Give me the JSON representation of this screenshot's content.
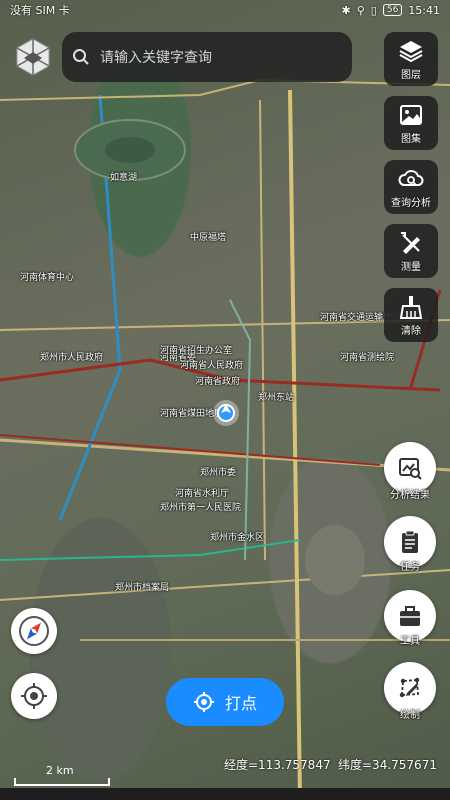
{
  "status_bar": {
    "carrier": "没有 SIM 卡",
    "battery": "56",
    "time": "15:41"
  },
  "search": {
    "placeholder": "请输入关键字查询"
  },
  "toolbar": [
    {
      "id": "layers",
      "label": "图层",
      "icon": "layers-icon"
    },
    {
      "id": "gallery",
      "label": "图集",
      "icon": "image-icon"
    },
    {
      "id": "query",
      "label": "查询分析",
      "icon": "cloud-search-icon"
    },
    {
      "id": "measure",
      "label": "测量",
      "icon": "ruler-pencil-icon"
    },
    {
      "id": "clear",
      "label": "清除",
      "icon": "broom-icon"
    }
  ],
  "actions": [
    {
      "id": "analysis-result",
      "label": "分析结果",
      "icon": "chart-search-icon"
    },
    {
      "id": "task",
      "label": "任务",
      "icon": "clipboard-icon"
    },
    {
      "id": "tools",
      "label": "工具",
      "icon": "toolbox-icon"
    },
    {
      "id": "draw",
      "label": "绘制",
      "icon": "draw-polygon-icon"
    }
  ],
  "point_button": "打点",
  "scale_label": "2 km",
  "coordinates": {
    "longitude": "经度=113.757847",
    "latitude": "纬度=34.757671"
  },
  "map_labels": [
    "河南省委",
    "河南省人民政府",
    "河南省政府",
    "河南省煤田地质局",
    "郑州东站",
    "郑州市人民政府",
    "河南省测绘院",
    "河南省招生办公室",
    "郑州市第一人民医院",
    "河南省交通运输厅",
    "郑州市金水区",
    "河南体育中心",
    "郑州市档案局",
    "河南省水利厅",
    "郑州市委",
    "如意湖",
    "中原福塔"
  ]
}
